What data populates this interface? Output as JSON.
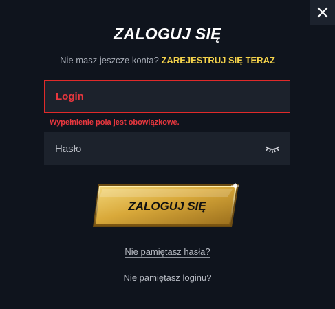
{
  "close_label": "×",
  "title": "ZALOGUJ SIĘ",
  "register": {
    "prompt": "Nie masz jeszcze konta?",
    "link": "ZAREJESTRUJ SIĘ TERAZ"
  },
  "login": {
    "placeholder": "Login",
    "value": "",
    "error": "Wypełnienie pola jest obowiązkowe."
  },
  "password": {
    "placeholder": "Hasło",
    "value": ""
  },
  "submit_label": "ZALOGUJ SIĘ",
  "forgot_password": "Nie pamiętasz hasła?",
  "forgot_login": "Nie pamiętasz loginu?",
  "colors": {
    "background": "#0f141d",
    "field": "#1c222c",
    "error": "#e8373e",
    "accent": "#f5d34b",
    "gold": "#d9a93a"
  },
  "icons": {
    "close": "close-icon",
    "password_toggle": "eye-closed-icon"
  }
}
